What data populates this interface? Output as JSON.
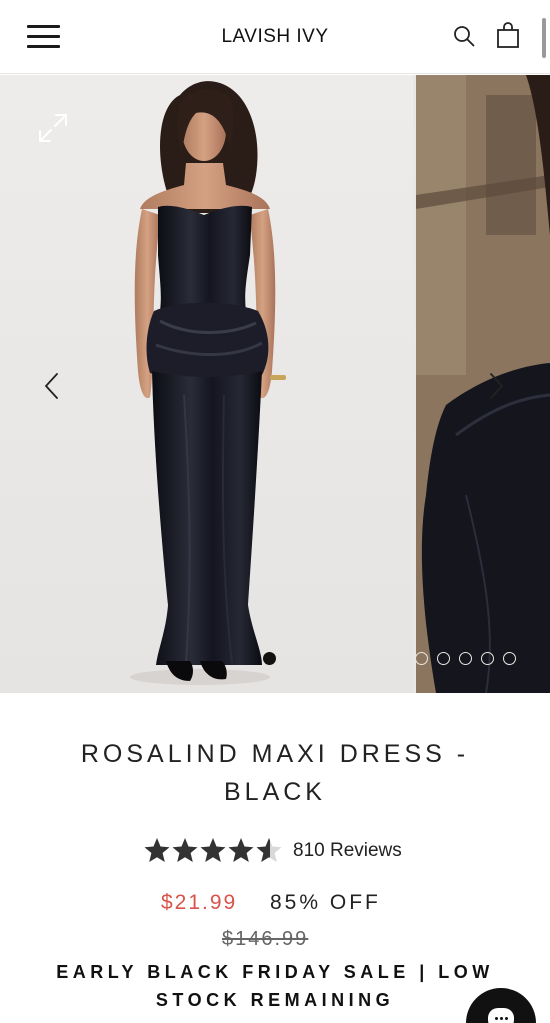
{
  "header": {
    "brand": "LAVISH IVY",
    "icons": [
      "menu-icon",
      "search-icon",
      "shopping-bag-icon"
    ]
  },
  "gallery": {
    "slide_count": 5,
    "active_slide": 1,
    "icons": [
      "expand-icon",
      "chevron-left-icon",
      "chevron-right-icon"
    ]
  },
  "product": {
    "title": "ROSALIND MAXI DRESS - BLACK",
    "rating_value": 4.5,
    "rating_max": 5,
    "reviews_label": "810 Reviews",
    "sale_price": "$21.99",
    "discount_label": "85% OFF",
    "original_price": "$146.99",
    "promo_text": "EARLY BLACK FRIDAY SALE | LOW STOCK REMAINING"
  },
  "colors": {
    "accent_price": "#d9534a",
    "text": "#222222",
    "star": "#333333",
    "chat_bubble": "#111111"
  },
  "chat": {
    "icon": "chat-bubble-icon"
  }
}
